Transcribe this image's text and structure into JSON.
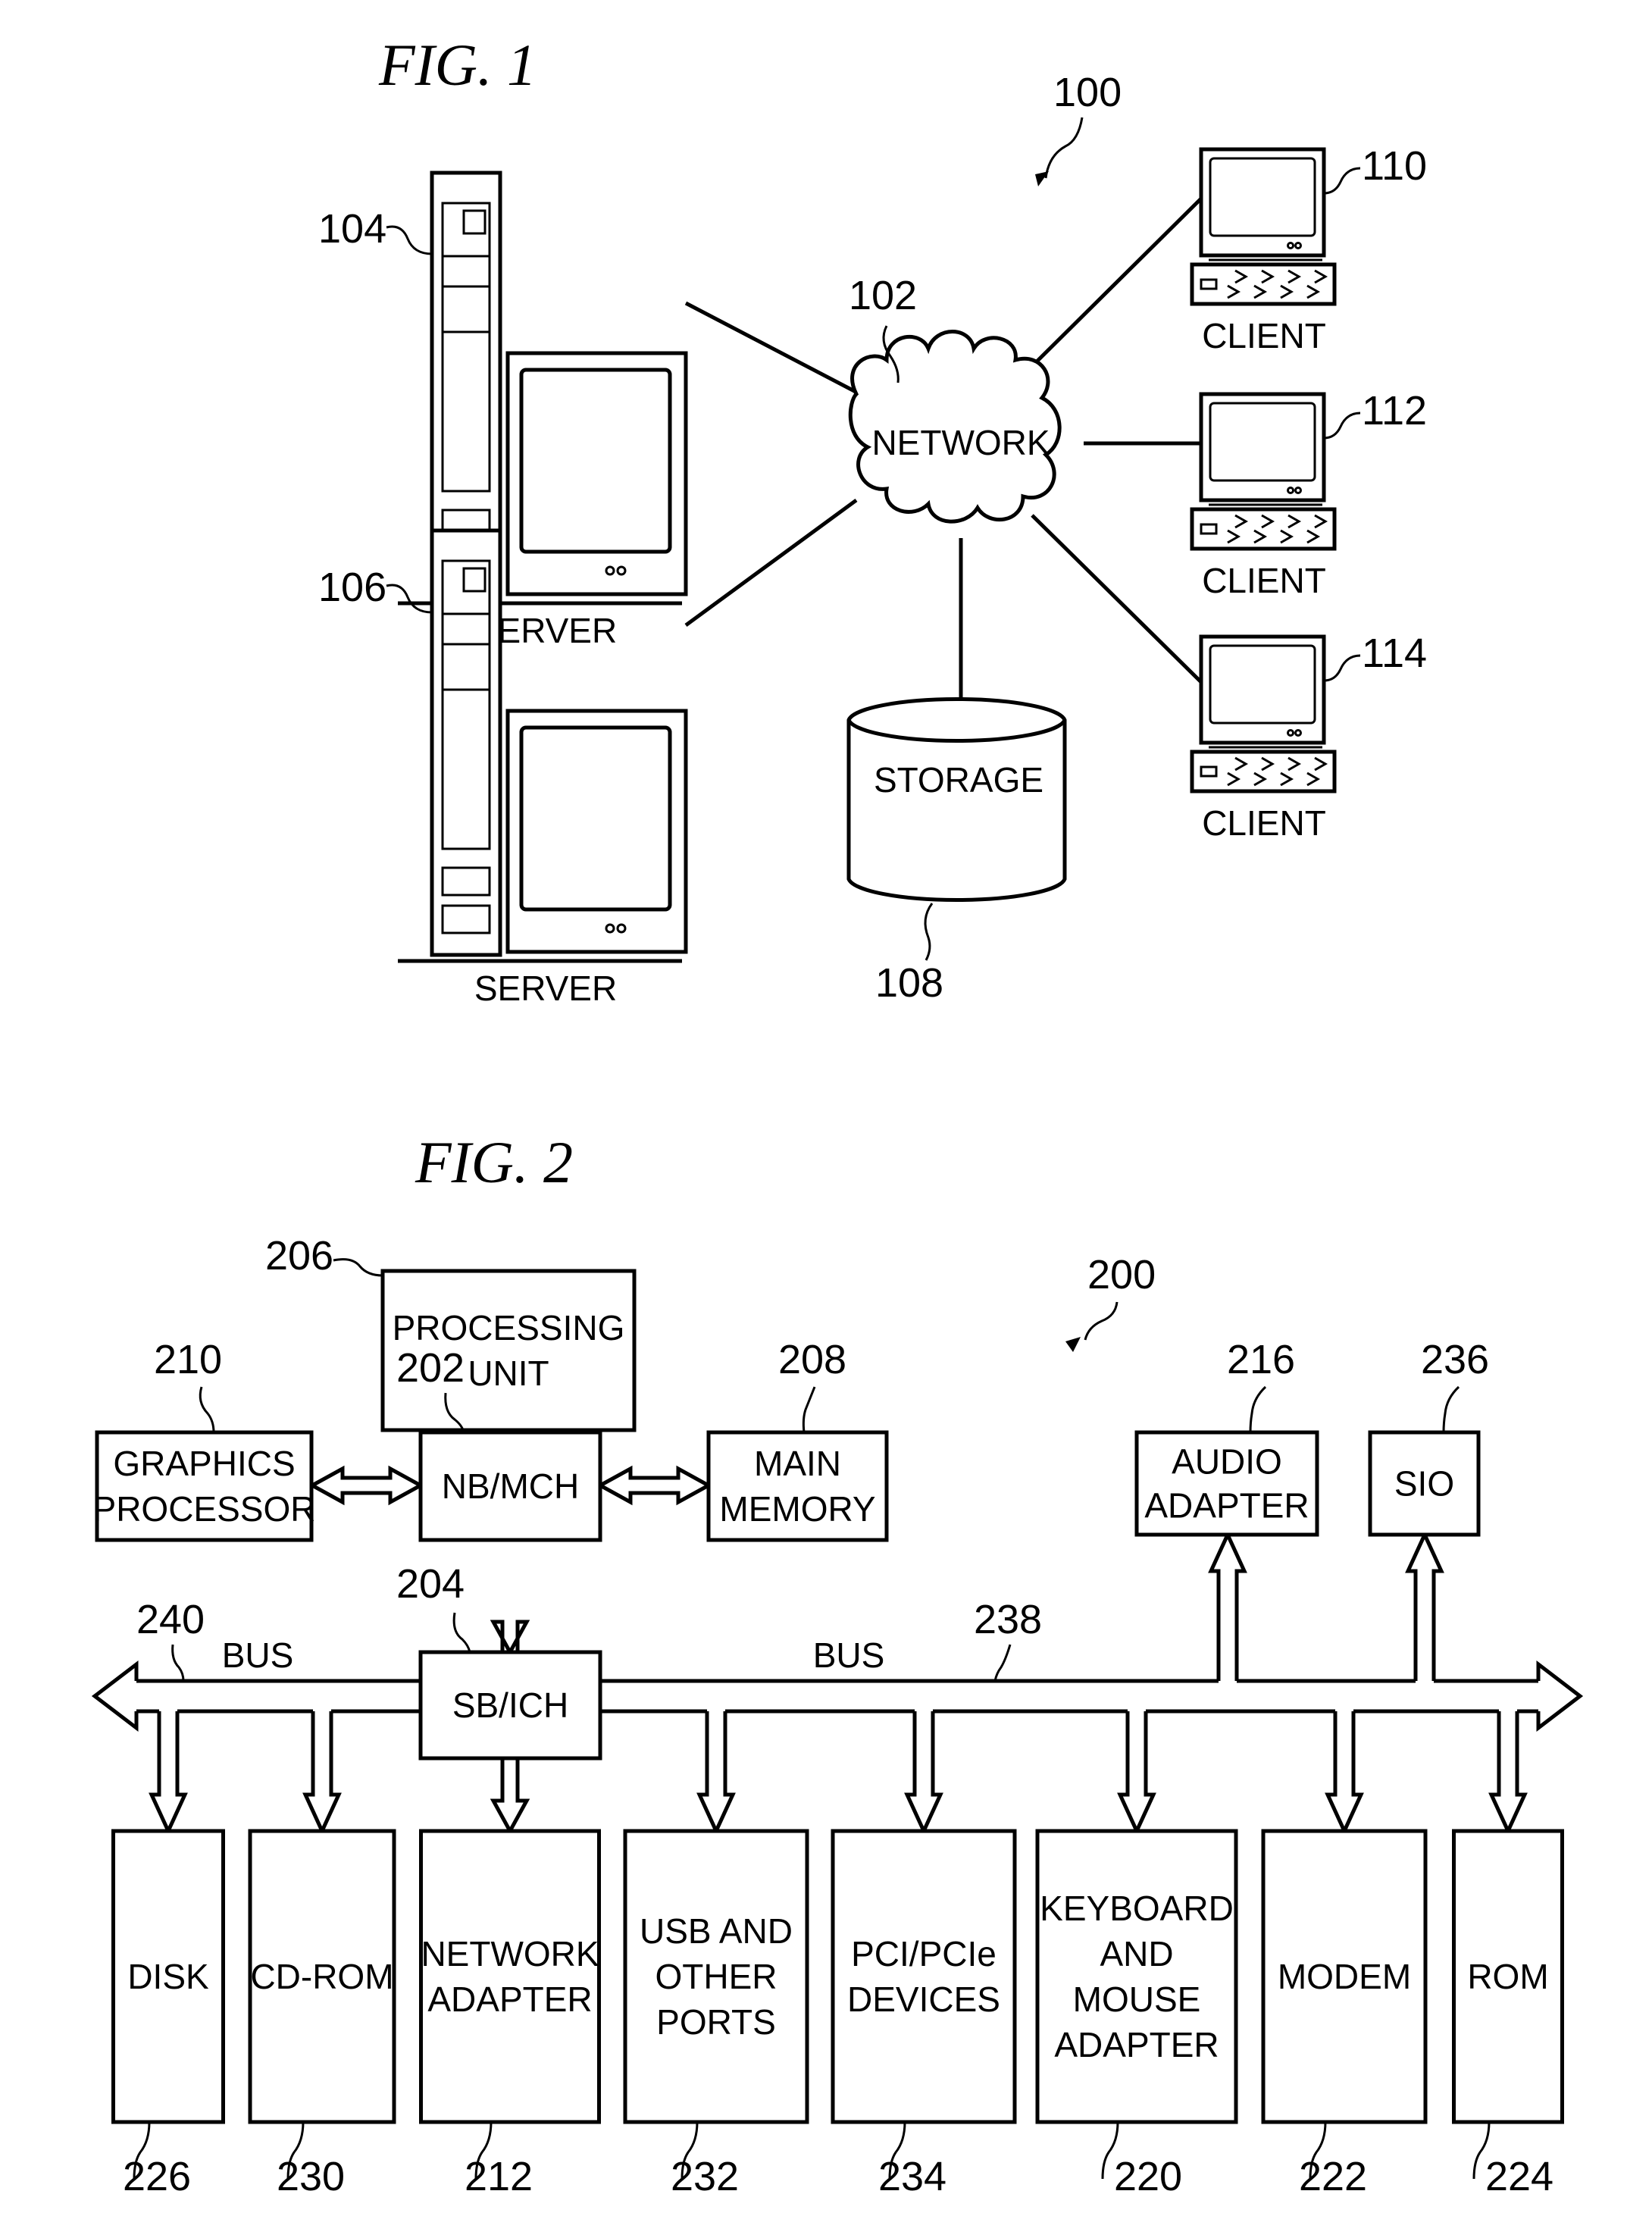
{
  "fig1": {
    "title": "FIG. 1",
    "system_ref": "100",
    "network": {
      "label": "NETWORK",
      "ref": "102"
    },
    "servers": [
      {
        "label": "SERVER",
        "ref": "104"
      },
      {
        "label": "SERVER",
        "ref": "106"
      }
    ],
    "storage": {
      "label": "STORAGE",
      "ref": "108"
    },
    "clients": [
      {
        "label": "CLIENT",
        "ref": "110"
      },
      {
        "label": "CLIENT",
        "ref": "112"
      },
      {
        "label": "CLIENT",
        "ref": "114"
      }
    ]
  },
  "fig2": {
    "title": "FIG. 2",
    "system_ref": "200",
    "processing_unit": {
      "lines": [
        "PROCESSING",
        "UNIT"
      ],
      "ref": "206"
    },
    "nb_mch": {
      "lines": [
        "NB/MCH"
      ],
      "ref": "202"
    },
    "graphics": {
      "lines": [
        "GRAPHICS",
        "PROCESSOR"
      ],
      "ref": "210"
    },
    "main_memory": {
      "lines": [
        "MAIN",
        "MEMORY"
      ],
      "ref": "208"
    },
    "sb_ich": {
      "lines": [
        "SB/ICH"
      ],
      "ref": "204"
    },
    "audio": {
      "lines": [
        "AUDIO",
        "ADAPTER"
      ],
      "ref": "216"
    },
    "sio": {
      "lines": [
        "SIO"
      ],
      "ref": "236"
    },
    "bus_left": {
      "label": "BUS",
      "ref": "240"
    },
    "bus_right": {
      "label": "BUS",
      "ref": "238"
    },
    "devices": [
      {
        "lines": [
          "DISK"
        ],
        "ref": "226"
      },
      {
        "lines": [
          "CD-ROM"
        ],
        "ref": "230"
      },
      {
        "lines": [
          "NETWORK",
          "ADAPTER"
        ],
        "ref": "212"
      },
      {
        "lines": [
          "USB AND",
          "OTHER",
          "PORTS"
        ],
        "ref": "232"
      },
      {
        "lines": [
          "PCI/PCIe",
          "DEVICES"
        ],
        "ref": "234"
      },
      {
        "lines": [
          "KEYBOARD",
          "AND",
          "MOUSE",
          "ADAPTER"
        ],
        "ref": "220"
      },
      {
        "lines": [
          "MODEM"
        ],
        "ref": "222"
      },
      {
        "lines": [
          "ROM"
        ],
        "ref": "224"
      }
    ]
  }
}
